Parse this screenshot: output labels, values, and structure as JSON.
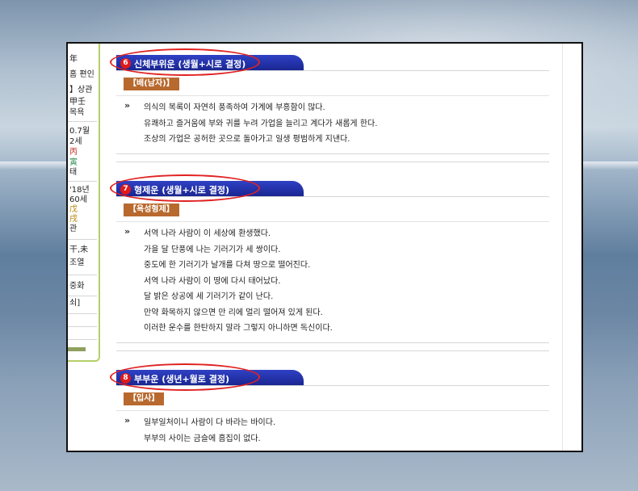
{
  "sidebar": {
    "rows": [
      {
        "text": "年"
      },
      {
        "text": "홈 편인"
      },
      {
        "text": "】상관"
      },
      {
        "text": "甲壬"
      },
      {
        "text": "목욕"
      },
      {
        "text": "0.7월"
      },
      {
        "text": "2세"
      },
      {
        "text": "丙",
        "color": "#c0392b"
      },
      {
        "text": "寅",
        "color": "#2e8b57"
      },
      {
        "text": "태"
      },
      {
        "text": "'18년"
      },
      {
        "text": "60세"
      },
      {
        "text": "戊",
        "color": "#b8860b"
      },
      {
        "text": "戌",
        "color": "#b8860b"
      },
      {
        "text": "관"
      },
      {
        "text": "干,未"
      },
      {
        "text": "조열"
      },
      {
        "text": "중화"
      },
      {
        "text": "쇠]"
      }
    ]
  },
  "sections": [
    {
      "number": "6",
      "title": "신체부위운 (생월+시로 결정)",
      "badge": "【배(남자)】",
      "arrow": "»",
      "lines": [
        "의식의 복록이 자연히 풍족하여 가계에 부흥함이 많다.",
        "유쾌하고 즐거움에 부와 귀를 누려 가업을 늘리고 계다가 새롭게 한다.",
        "조상의 가업은 공허한 곳으로 돌아가고 일생 평범하게 지낸다."
      ]
    },
    {
      "number": "7",
      "title": "형제운 (생월+시로 결정)",
      "badge": "【욕성형제】",
      "arrow": "»",
      "lines": [
        "서역 나라 사람이 이 세상에 환생했다.",
        "가을 달 단풍에 나는 기러기가 세 쌍이다.",
        "중도에 한 기러기가 날개를 다쳐 땅으로 떨어진다.",
        "서역 나라 사람이 이 땅에 다시 태어났다.",
        "달 밝은 상공에 세 기러기가 같이 난다.",
        "만약 화목하지 않으면 만 리에 멀리 떨어져 있게 된다.",
        "이러한 운수를 한탄하지 말라 그렇지 아니하면 독신이다."
      ]
    },
    {
      "number": "8",
      "title": "부부운 (생년+월로 결정)",
      "badge": "【입사】",
      "arrow": "»",
      "lines": [
        "일부일처이니 사람이 다 바라는 바이다.",
        "부부의 사이는 금슬에 흠집이 없다."
      ]
    }
  ]
}
